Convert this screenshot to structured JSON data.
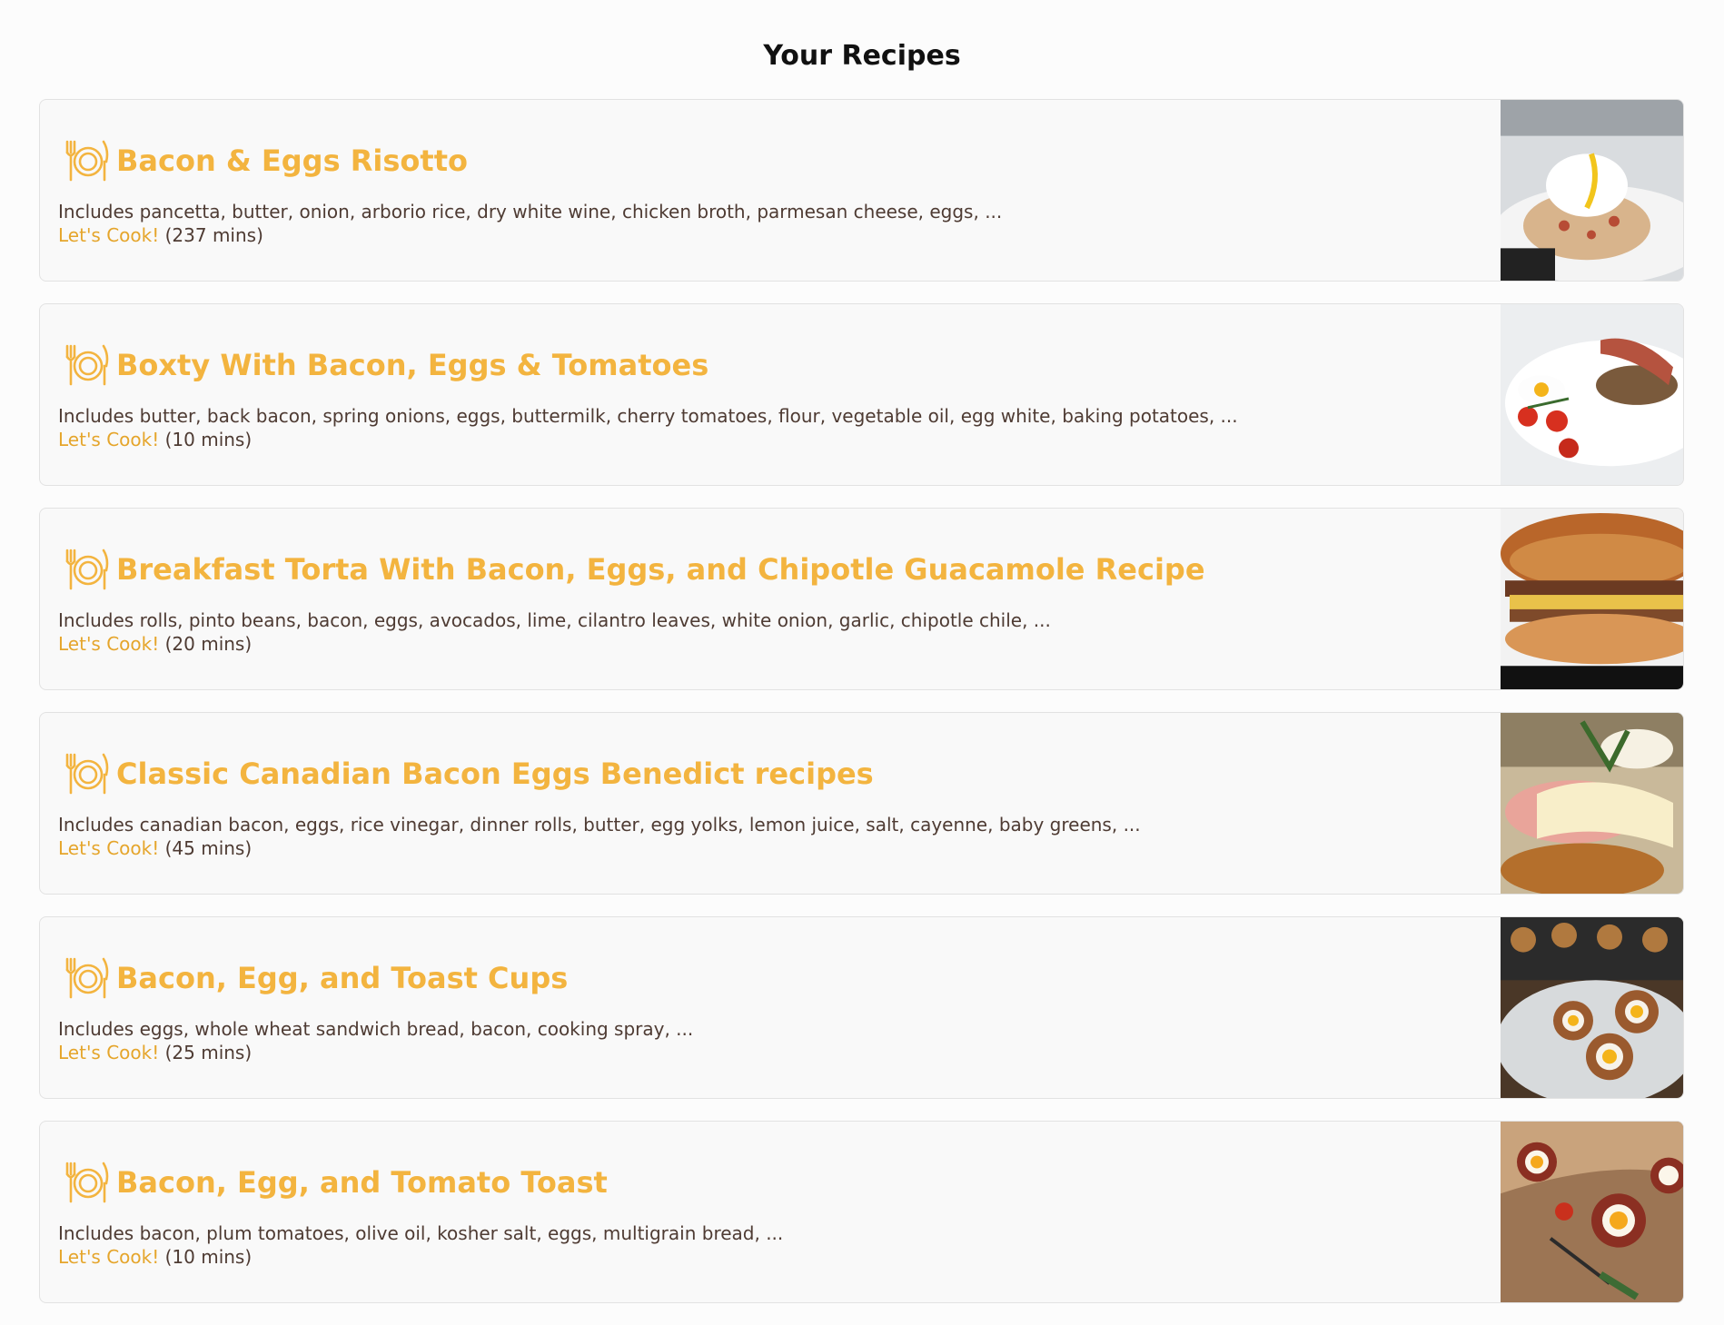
{
  "page": {
    "title": "Your Recipes"
  },
  "theme": {
    "accent": "#f3b43f",
    "link": "#e5a52b",
    "text": "#4e3b33",
    "card_bg": "#f9f9f9"
  },
  "recipes": [
    {
      "title": "Bacon & Eggs Risotto",
      "ingredients": "Includes pancetta, butter, onion, arborio rice, dry white wine, chicken broth, parmesan cheese, eggs, ...",
      "cook_label": "Let's Cook!",
      "time": "(237 mins)",
      "icon": "dish-icon",
      "image": "risotto-photo"
    },
    {
      "title": "Boxty With Bacon, Eggs & Tomatoes",
      "ingredients": "Includes butter, back bacon, spring onions, eggs, buttermilk, cherry tomatoes, flour, vegetable oil, egg white, baking potatoes, ...",
      "cook_label": "Let's Cook!",
      "time": "(10 mins)",
      "icon": "dish-icon",
      "image": "boxty-photo"
    },
    {
      "title": "Breakfast Torta With Bacon, Eggs, and Chipotle Guacamole Recipe",
      "ingredients": "Includes rolls, pinto beans, bacon, eggs, avocados, lime, cilantro leaves, white onion, garlic, chipotle chile, ...",
      "cook_label": "Let's Cook!",
      "time": "(20 mins)",
      "icon": "dish-icon",
      "image": "torta-photo"
    },
    {
      "title": "Classic Canadian Bacon Eggs Benedict recipes",
      "ingredients": "Includes canadian bacon, eggs, rice vinegar, dinner rolls, butter, egg yolks, lemon juice, salt, cayenne, baby greens, ...",
      "cook_label": "Let's Cook!",
      "time": "(45 mins)",
      "icon": "dish-icon",
      "image": "benedict-photo"
    },
    {
      "title": "Bacon, Egg, and Toast Cups",
      "ingredients": "Includes eggs, whole wheat sandwich bread, bacon, cooking spray, ...",
      "cook_label": "Let's Cook!",
      "time": "(25 mins)",
      "icon": "dish-icon",
      "image": "toast-cups-photo"
    },
    {
      "title": "Bacon, Egg, and Tomato Toast",
      "ingredients": "Includes bacon, plum tomatoes, olive oil, kosher salt, eggs, multigrain bread, ...",
      "cook_label": "Let's Cook!",
      "time": "(10 mins)",
      "icon": "dish-icon",
      "image": "tomato-toast-photo"
    }
  ]
}
